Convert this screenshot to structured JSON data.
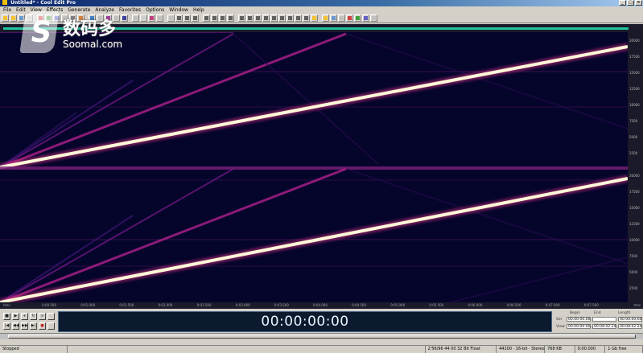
{
  "window": {
    "title": "Untitled* - Cool Edit Pro",
    "buttons": [
      "_",
      "□",
      "×"
    ]
  },
  "menu": [
    "File",
    "Edit",
    "View",
    "Effects",
    "Generate",
    "Analyze",
    "Favorites",
    "Options",
    "Window",
    "Help"
  ],
  "watermark": {
    "chinese": "数码多",
    "english": "Soomal.com"
  },
  "timeline": {
    "labels": [
      "hms",
      "0:00.500",
      "0:01.000",
      "0:01.500",
      "0:02.000",
      "0:02.500",
      "0:03.000",
      "0:03.500",
      "0:04.000",
      "0:04.500",
      "0:05.000",
      "0:05.500",
      "0:06.000",
      "0:06.500",
      "0:07.000",
      "0:07.500",
      "hms"
    ]
  },
  "freq_ruler": {
    "top": [
      "20000",
      "17500",
      "15000",
      "12500",
      "10000",
      "7500",
      "5000",
      "2500"
    ],
    "bottom": [
      "20000",
      "17500",
      "15000",
      "12500",
      "10000",
      "7500",
      "5000",
      "2500"
    ]
  },
  "transport": [
    "■",
    "▶",
    "⏸",
    "↻",
    "∞",
    "",
    "|◀",
    "◀◀",
    "▶▶",
    "▶|",
    "●",
    ""
  ],
  "time_display": "00:00:00:00",
  "selection": {
    "headers": {
      "begin": "Begin",
      "end": "End",
      "length": "Length"
    },
    "rows": [
      {
        "label": "Sel",
        "begin": "00:00:00:00",
        "end": "",
        "length": "00:00:00:00"
      },
      {
        "label": "View",
        "begin": "00:00:00:00",
        "end": "00:08:02:24",
        "length": "00:08:02:24"
      }
    ]
  },
  "status": [
    "Stopped",
    "",
    "2'56/96 44 00 32 Bit Float",
    "44100 · 16-bit · Stereo",
    "768 KB",
    "0:00.000",
    "1 Gb free"
  ],
  "colors": {
    "spectro_bg": "#05052e",
    "sweep": "#fff8d8",
    "harmonic": "#b0208a",
    "accent_green": "#21c4a0"
  }
}
